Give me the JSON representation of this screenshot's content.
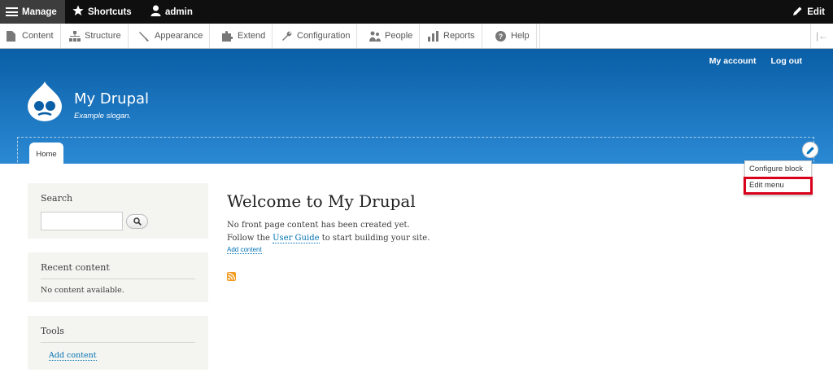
{
  "toolbar": {
    "manage": "Manage",
    "shortcuts": "Shortcuts",
    "user": "admin",
    "edit": "Edit"
  },
  "tray": {
    "items": [
      "Content",
      "Structure",
      "Appearance",
      "Extend",
      "Configuration",
      "People",
      "Reports",
      "Help"
    ]
  },
  "header": {
    "secondary_menu": [
      "My account",
      "Log out"
    ],
    "site_name": "My Drupal",
    "site_slogan": "Example slogan.",
    "primary_menu": [
      "Home"
    ]
  },
  "contextual_menu": {
    "items": [
      "Configure block",
      "Edit menu"
    ]
  },
  "sidebar": {
    "search": {
      "title": "Search",
      "value": ""
    },
    "recent": {
      "title": "Recent content",
      "text": "No content available."
    },
    "tools": {
      "title": "Tools",
      "link": "Add content"
    }
  },
  "main": {
    "title": "Welcome to My Drupal",
    "line1": "No front page content has been created yet.",
    "line2_before": "Follow the ",
    "line2_link": "User Guide",
    "line2_after": " to start building your site.",
    "add_content": "Add content"
  },
  "colors": {
    "header_top": "#0a5fa6",
    "header_bottom": "#2b89d4",
    "link": "#0071b3",
    "highlight": "#d9001b",
    "rss": "#f29b21"
  }
}
